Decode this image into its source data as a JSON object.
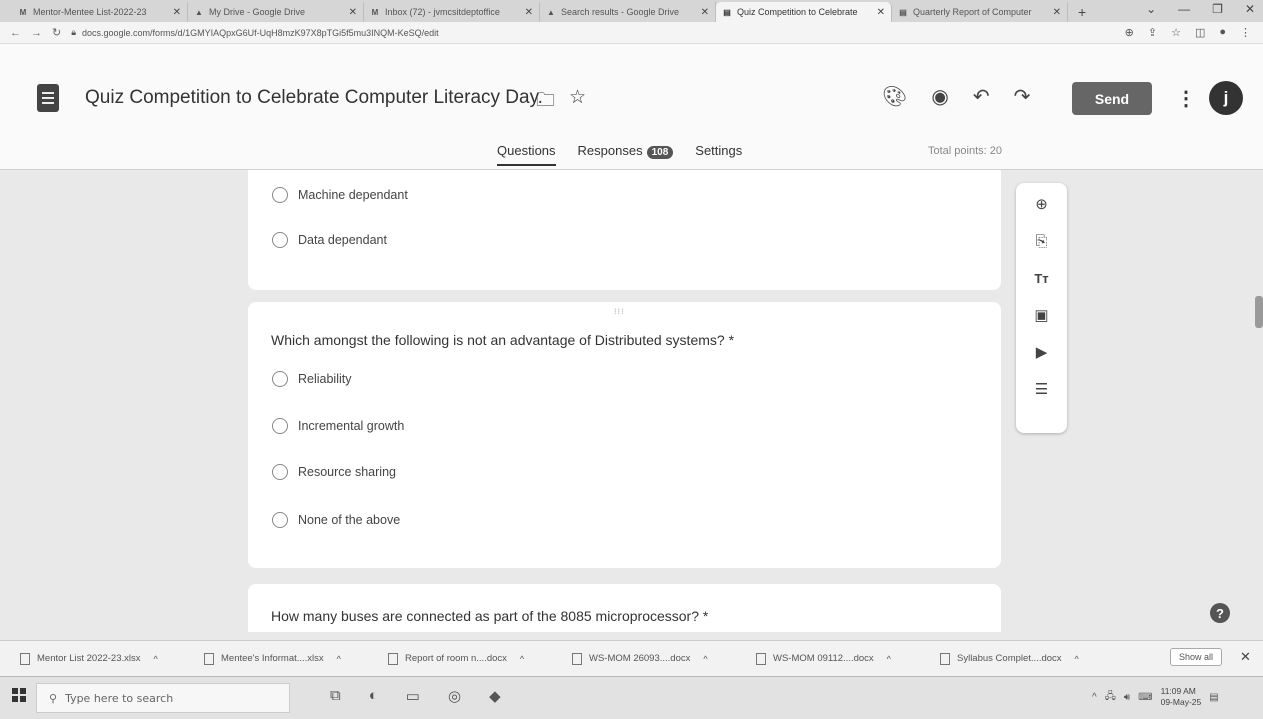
{
  "browser": {
    "tabs": [
      {
        "label": "Mentor-Mentee List-2022-23",
        "favicon": "M"
      },
      {
        "label": "My Drive - Google Drive",
        "favicon": "▲"
      },
      {
        "label": "Inbox (72) - jvmcsitdeptoffice",
        "favicon": "M"
      },
      {
        "label": "Search results - Google Drive",
        "favicon": "▲"
      },
      {
        "label": "Quiz Competition to Celebrate",
        "favicon": "▤"
      },
      {
        "label": "Quarterly Report of Computer",
        "favicon": "▤"
      }
    ],
    "address": "docs.google.com/forms/d/1GMYIAQpxG6Uf-UqH8mzK97X8pTGi5f5mu3INQM-KeSQ/edit"
  },
  "form": {
    "title": "Quiz Competition to Celebrate Computer Literacy Day.",
    "send_label": "Send",
    "avatar_letter": "j",
    "tabs": [
      "Questions",
      "Responses",
      "Settings"
    ],
    "responses_count": "108",
    "total_points": "Total points: 20"
  },
  "questions": {
    "prev_options": [
      "Machine dependant",
      "Data dependant"
    ],
    "q2": {
      "text": "Which amongst the following is not an advantage of Distributed systems?",
      "required_mark": "*",
      "options": [
        "Reliability",
        "Incremental growth",
        "Resource sharing",
        "None of the above"
      ]
    },
    "q3": {
      "text": "How many buses are connected as part of the 8085 microprocessor?",
      "required_mark": "*"
    }
  },
  "downloads": {
    "items": [
      "Mentor List 2022-23.xlsx",
      "Mentee's Informat....xlsx",
      "Report of room n....docx",
      "WS-MOM 26093....docx",
      "WS-MOM 09112....docx",
      "Syllabus Complet....docx"
    ],
    "show_all": "Show all"
  },
  "taskbar": {
    "search_placeholder": "Type here to search",
    "time": "11:09 AM",
    "date": "09-May-25"
  }
}
